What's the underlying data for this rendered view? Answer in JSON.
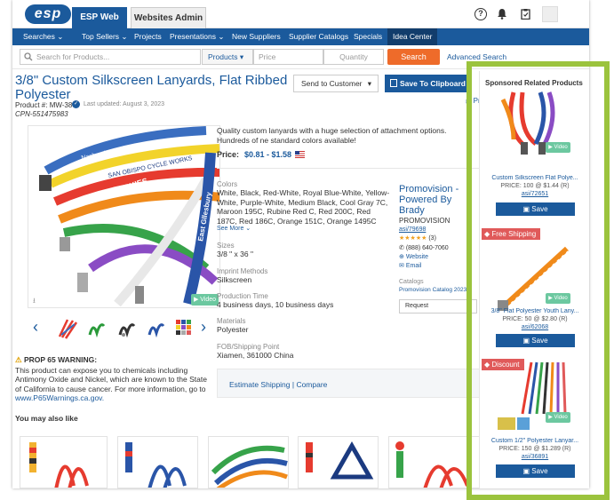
{
  "topbar": {
    "logo": "esp",
    "tabs": [
      {
        "label": "ESP Web"
      },
      {
        "label": "Websites Admin"
      }
    ],
    "help_icon": "question-circle-icon",
    "bell_icon": "bell-icon",
    "clipboard_icon": "clipboard-icon"
  },
  "nav": {
    "items": [
      "Searches",
      "Top Sellers",
      "Projects",
      "Presentations",
      "New Suppliers",
      "Supplier Catalogs",
      "Specials",
      "Idea Center"
    ],
    "current": "Idea Center"
  },
  "search": {
    "placeholder": "Search for Products...",
    "category": "Products",
    "price_placeholder": "Price",
    "quantity_placeholder": "Quantity",
    "button": "Search",
    "advanced": "Advanced Search"
  },
  "product": {
    "title": "3/8\" Custom Silkscreen Lanyards, Flat Ribbed Polyester",
    "product_no": "Product #: MW-38",
    "updated": "Last updated: August 3, 2023",
    "cpn": "CPN-551475983",
    "send_label": "Send to Customer",
    "clipboard_label": "Save To Clipboard",
    "print_label": "Pr",
    "description": "Quality custom lanyards with a huge selection of attachment options. Hundreds of ne standard colors available!",
    "price_label": "Price:",
    "price": "$0.81 - $1.58",
    "colors_label": "Colors",
    "colors": "White, Black, Red-White, Royal Blue-White, Yellow-White, Purple-White, Medium Black, Cool Gray 7C, Maroon 195C, Rubine Red C, Red 200C, Red 187C, Red 186C, Orange 151C, Orange 1495C",
    "see_more": "See More",
    "sizes_label": "Sizes",
    "sizes": "3/8 \" x 36 \"",
    "imprint_label": "Imprint Methods",
    "imprint": "Silkscreen",
    "production_label": "Production Time",
    "production": "4 business days, 10 business days",
    "materials_label": "Materials",
    "materials": "Polyester",
    "fob_label": "FOB/Shipping Point",
    "fob": "Xiamen, 361000 China",
    "shipping": "Estimate Shipping | Compare",
    "video": "Video",
    "image_text": [
      "Nashua Leadership Conference",
      "SAN OBISPO CYCLE WORKS",
      "DCHS HUSKIES",
      "East Gllesbury"
    ],
    "warning_title": "PROP 65 WARNING:",
    "warning_text": "This product can expose you to chemicals including Antimony Oxide and Nickel, which are known to the State of California to cause cancer. For more information, go to",
    "warning_link": "www.P65Warnings.ca.gov."
  },
  "supplier": {
    "name": "Promovision - Powered By Brady",
    "code": "PROMOVISION",
    "asi": "asi/79698",
    "rating": 5,
    "stars": "★★★★★",
    "reviews": "(3)",
    "phone": "(888) 640-7060",
    "website": "Website",
    "email": "Email",
    "catalogs_label": "Catalogs",
    "catalog": "Promovision Catalog 2023",
    "request": "Request"
  },
  "may_like": {
    "title": "You may also like",
    "count": 5
  },
  "sponsored": {
    "title": "Sponsored Related Products",
    "save_label": "Save",
    "items": [
      {
        "name": "Custom Silkscreen Flat Polye...",
        "price": "PRICE: 100 @ $1.44 (R)",
        "asi": "asi/72651",
        "badge": ""
      },
      {
        "name": "3/8\" Flat Polyester Youth Lany...",
        "price": "PRICE: 50 @ $2.80 (R)",
        "asi": "asi/62068",
        "badge": "Free Shipping"
      },
      {
        "name": "Custom 1/2\" Polyester Lanyar...",
        "price": "PRICE: 150 @ $1.289 (R)",
        "asi": "asi/36891",
        "badge": "Discount"
      }
    ]
  },
  "colors": {
    "brand": "#1b5a9c",
    "accent": "#ee6b2a",
    "highlight": "#9bc33d",
    "badge": "#e05a5a"
  }
}
